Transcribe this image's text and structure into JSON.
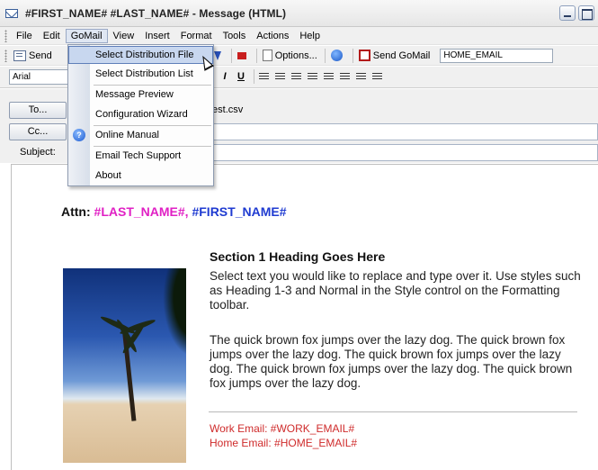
{
  "window": {
    "title": "#FIRST_NAME# #LAST_NAME# - Message (HTML)"
  },
  "menubar": {
    "items": [
      "File",
      "Edit",
      "GoMail",
      "View",
      "Insert",
      "Format",
      "Tools",
      "Actions",
      "Help"
    ],
    "active": "GoMail"
  },
  "toolbar": {
    "send_label": "Send",
    "options_label": "Options...",
    "send_gomail_label": "Send GoMail",
    "home_email_value": "HOME_EMAIL"
  },
  "formatting": {
    "font": "Arial",
    "italic": "I",
    "underline": "U"
  },
  "fields": {
    "to_label": "To...",
    "to_value": "test.csv",
    "cc_label": "Cc...",
    "cc_value": "",
    "subject_label": "Subject:",
    "subject_value": ""
  },
  "dropdown": {
    "items": [
      "Select Distribution File",
      "Select Distribution List",
      "Message Preview",
      "Configuration Wizard",
      "Online Manual",
      "Email Tech Support",
      "About"
    ],
    "highlighted_index": 0,
    "help_glyph": "?"
  },
  "body": {
    "attn_label": "Attn:",
    "attn_last": "#LAST_NAME#,",
    "attn_first": "#FIRST_NAME#",
    "section_heading": "Section 1 Heading Goes Here",
    "para1": "Select text you would like to replace and type over it. Use styles such as Heading 1-3 and Normal in the Style control on the Formatting toolbar.",
    "para2": "The quick brown fox jumps over the lazy dog.  The quick brown fox jumps over the lazy dog.  The quick brown fox jumps over the lazy dog.  The quick brown fox jumps over the lazy dog.  The quick brown fox jumps over the lazy dog.",
    "work_email": "Work Email: #WORK_EMAIL#",
    "home_email": "Home Email: #HOME_EMAIL#"
  },
  "colors": {
    "last_name": "#e020c4",
    "first_name": "#1f3bd1",
    "email_text": "#cf2b2b",
    "menu_highlight": "#c8d7ef"
  }
}
